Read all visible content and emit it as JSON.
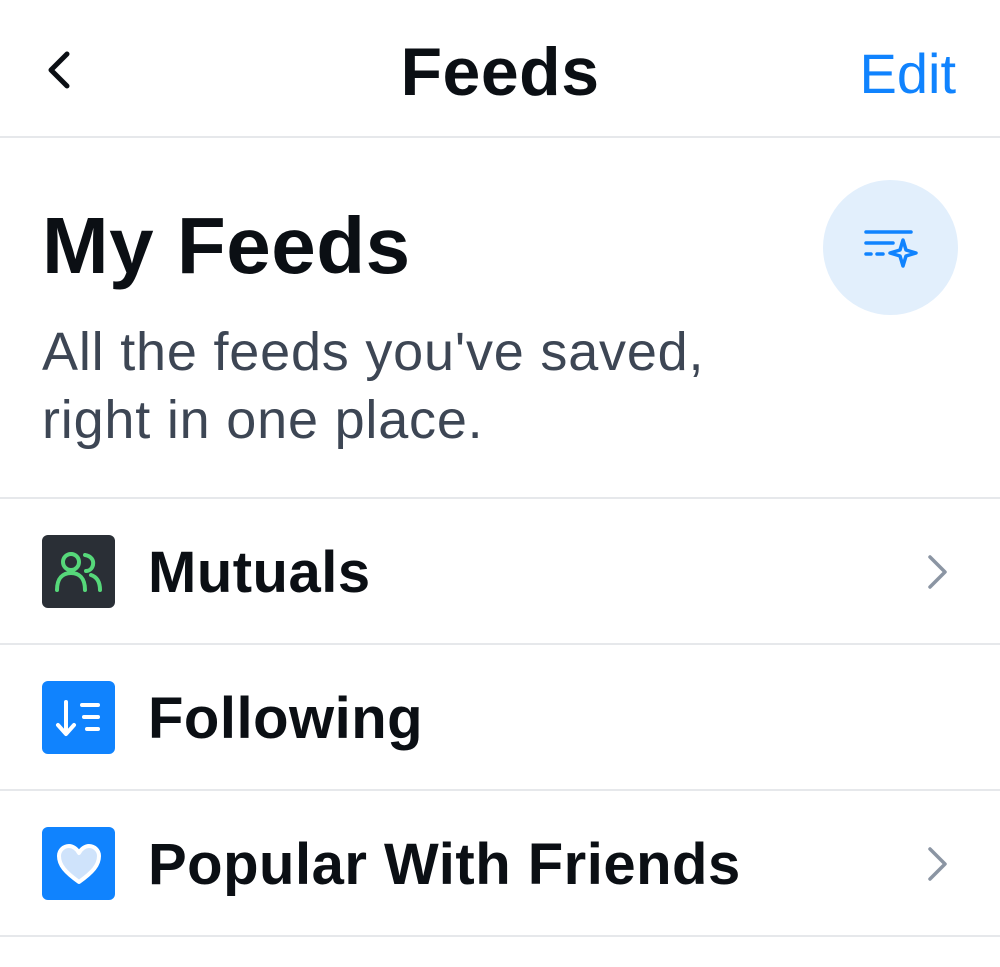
{
  "header": {
    "back_icon": "chevron-left-icon",
    "title": "Feeds",
    "edit_label": "Edit"
  },
  "intro": {
    "title": "My Feeds",
    "subtitle": "All the feeds you've saved, right in one place.",
    "discover_icon": "list-sparkle-icon"
  },
  "feeds": [
    {
      "label": "Mutuals",
      "icon": "people-icon",
      "icon_bg": "#2a2f36",
      "icon_color": "#56d87a",
      "has_chevron": true
    },
    {
      "label": "Following",
      "icon": "sort-list-icon",
      "icon_bg": "#1083fe",
      "icon_color": "#ffffff",
      "has_chevron": false
    },
    {
      "label": "Popular With Friends",
      "icon": "heart-icon",
      "icon_bg": "#1083fe",
      "icon_color": "#ffffff",
      "has_chevron": true
    }
  ],
  "colors": {
    "accent": "#1083fe",
    "divider": "#e6e8eb",
    "text_primary": "#0b0f14",
    "text_secondary": "#3d4654",
    "discover_bg": "#e2effc",
    "chevron": "#8b95a3"
  }
}
